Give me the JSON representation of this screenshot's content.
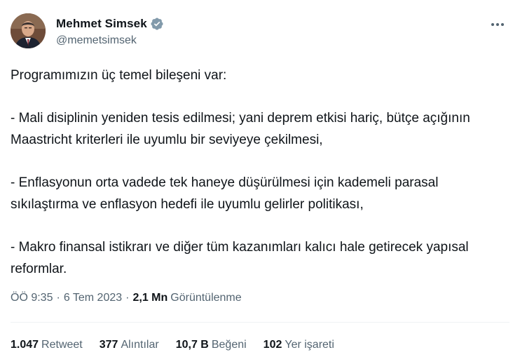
{
  "author": {
    "name": "Mehmet Simsek",
    "handle": "@memetsimsek",
    "verified": true,
    "verified_color": "#829aab"
  },
  "tweet": {
    "paragraphs": [
      "Programımızın üç temel bileşeni var:",
      "- Mali disiplinin yeniden tesis edilmesi; yani deprem etkisi hariç, bütçe açığının Maastricht kriterleri ile uyumlu bir seviyeye çekilmesi,",
      "- Enflasyonun orta vadede tek haneye düşürülmesi için kademeli parasal sıkılaştırma ve enflasyon hedefi ile uyumlu gelirler politikası,",
      "- Makro finansal istikrarı ve diğer tüm kazanımları kalıcı hale getirecek yapısal reformlar."
    ]
  },
  "meta": {
    "time": "ÖÖ 9:35",
    "separator": "·",
    "date": "6 Tem 2023",
    "views_count": "2,1 Mn",
    "views_label": "Görüntülenme"
  },
  "stats": {
    "retweets": {
      "count": "1.047",
      "label": "Retweet"
    },
    "quotes": {
      "count": "377",
      "label": "Alıntılar"
    },
    "likes": {
      "count": "10,7 B",
      "label": "Beğeni"
    },
    "bookmarks": {
      "count": "102",
      "label": "Yer işareti"
    }
  },
  "icons": {
    "more": "more-horizontal-icon",
    "verified": "verified-badge-icon"
  },
  "colors": {
    "text": "#0f1419",
    "secondary": "#536471",
    "divider": "#eff3f4"
  }
}
